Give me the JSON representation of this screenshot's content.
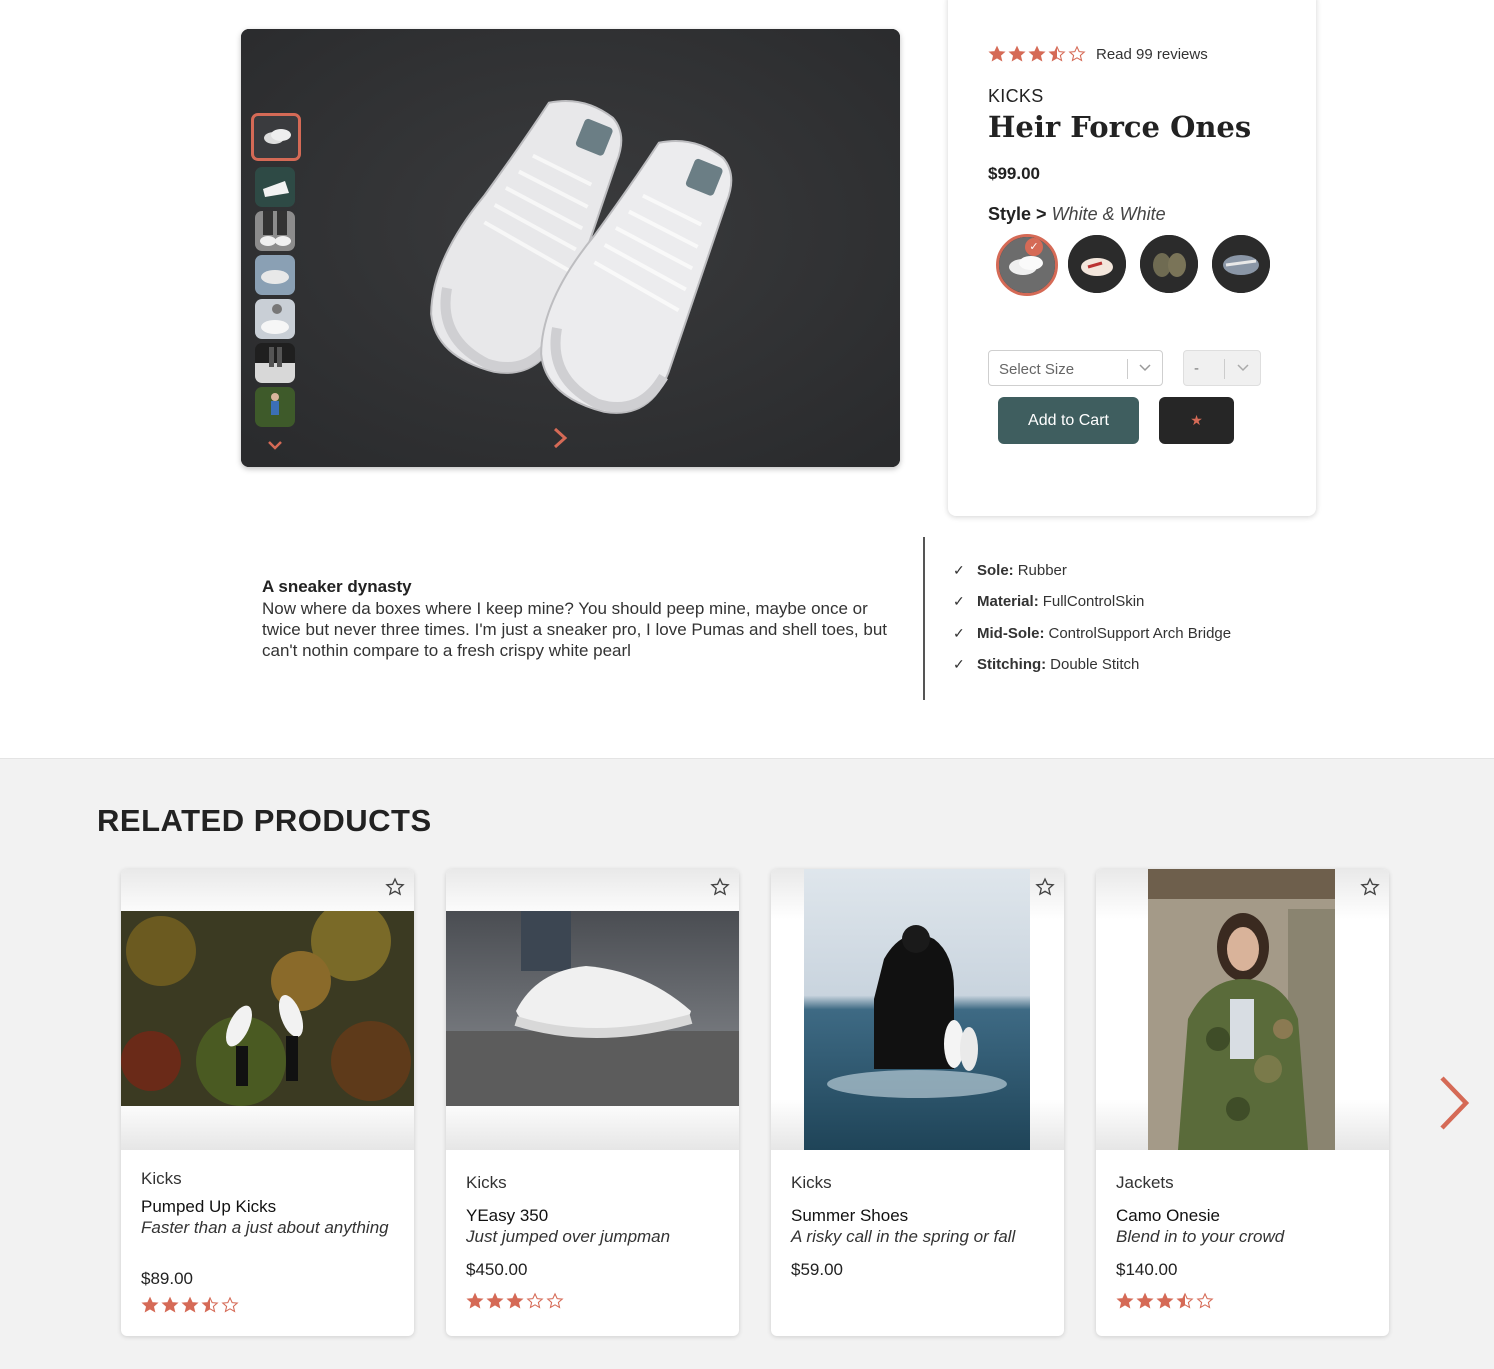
{
  "colors": {
    "accent": "#d56a56",
    "cart_button": "#3f5e5f",
    "dark": "#262626"
  },
  "product": {
    "rating": 3.5,
    "reviews_link": "Read 99 reviews",
    "category": "KICKS",
    "name": "Heir Force Ones",
    "price": "$99.00",
    "style_label": "Style >",
    "style_value": "White & White",
    "styles": [
      "sneaker-white",
      "sneaker-red-stripe",
      "sneaker-camo",
      "sneaker-blue"
    ],
    "size_placeholder": "Select Size",
    "qty_placeholder": "-",
    "add_to_cart": "Add to Cart",
    "favorite": "★"
  },
  "gallery": {
    "main_image": "white-sneakers-on-dark-background",
    "thumbnail_count": 7
  },
  "description": {
    "title": "A sneaker dynasty",
    "body": "Now where da boxes where I keep mine? You should peep mine, maybe once or twice but never three times. I'm just a sneaker pro, I love Pumas and shell toes, but can't nothin compare to a fresh crispy white pearl"
  },
  "features": [
    {
      "name": "Sole:",
      "value": "Rubber"
    },
    {
      "name": "Material:",
      "value": "FullControlSkin"
    },
    {
      "name": "Mid-Sole:",
      "value": "ControlSupport Arch Bridge"
    },
    {
      "name": "Stitching:",
      "value": "Double Stitch"
    }
  ],
  "related": {
    "title": "RELATED PRODUCTS",
    "items": [
      {
        "category": "Kicks",
        "name": "Pumped Up Kicks",
        "tagline": "Faster than a just about anything",
        "price": "$89.00",
        "rating": 3.5
      },
      {
        "category": "Kicks",
        "name": "YEasy 350",
        "tagline": "Just jumped over jumpman",
        "price": "$450.00",
        "rating": 3
      },
      {
        "category": "Kicks",
        "name": "Summer Shoes",
        "tagline": "A risky call in the spring or fall",
        "price": "$59.00",
        "rating": null
      },
      {
        "category": "Jackets",
        "name": "Camo Onesie",
        "tagline": "Blend in to your crowd",
        "price": "$140.00",
        "rating": 3.5
      }
    ]
  }
}
